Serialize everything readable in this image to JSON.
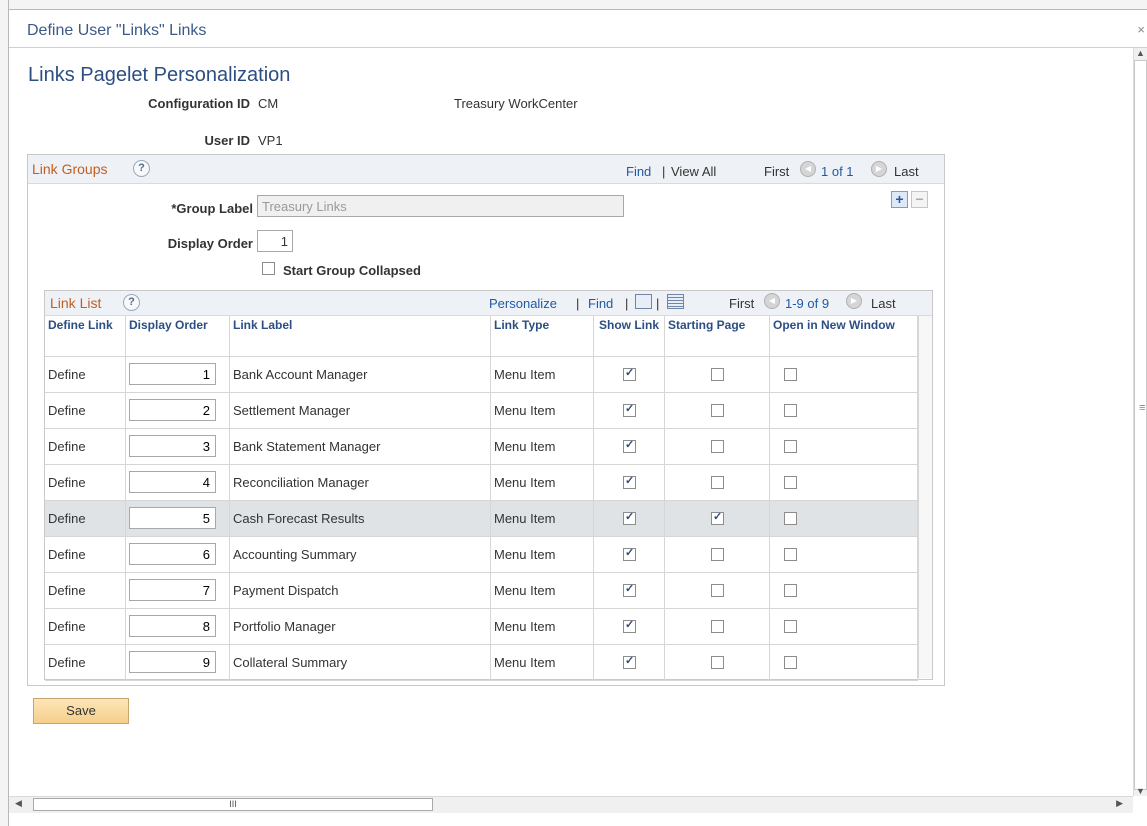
{
  "modal": {
    "title": "Define User \"Links\" Links",
    "close_glyph": "×"
  },
  "page": {
    "title": "Links Pagelet Personalization"
  },
  "config": {
    "config_id_label": "Configuration ID",
    "config_id_value": "CM",
    "config_desc": "Treasury WorkCenter",
    "user_id_label": "User ID",
    "user_id_value": "VP1"
  },
  "link_groups": {
    "title": "Link Groups",
    "help": "?",
    "find": "Find",
    "separator": "|",
    "view_all": "View All",
    "first": "First",
    "range": "1 of 1",
    "last": "Last",
    "add_glyph": "+",
    "delete_glyph": "−",
    "group_label_label": "*Group Label",
    "group_label_value": "Treasury Links",
    "display_order_label": "Display Order",
    "display_order_value": "1",
    "start_collapsed_label": "Start Group Collapsed"
  },
  "link_list": {
    "title": "Link List",
    "help": "?",
    "personalize": "Personalize",
    "find": "Find",
    "separator": "|",
    "first": "First",
    "range": "1-9 of 9",
    "last": "Last",
    "columns": [
      "Define Link",
      "Display Order",
      "Link Label",
      "Link Type",
      "Show Link",
      "Starting Page",
      "Open in New Window"
    ],
    "rows": [
      {
        "define": "Define",
        "order": "1",
        "label": "Bank Account Manager",
        "type": "Menu Item",
        "show": true,
        "starting": false,
        "new_window": false
      },
      {
        "define": "Define",
        "order": "2",
        "label": "Settlement Manager",
        "type": "Menu Item",
        "show": true,
        "starting": false,
        "new_window": false
      },
      {
        "define": "Define",
        "order": "3",
        "label": "Bank Statement Manager",
        "type": "Menu Item",
        "show": true,
        "starting": false,
        "new_window": false
      },
      {
        "define": "Define",
        "order": "4",
        "label": "Reconciliation Manager",
        "type": "Menu Item",
        "show": true,
        "starting": false,
        "new_window": false
      },
      {
        "define": "Define",
        "order": "5",
        "label": "Cash Forecast Results",
        "type": "Menu Item",
        "show": true,
        "starting": true,
        "new_window": false,
        "highlight": true
      },
      {
        "define": "Define",
        "order": "6",
        "label": "Accounting Summary",
        "type": "Menu Item",
        "show": true,
        "starting": false,
        "new_window": false
      },
      {
        "define": "Define",
        "order": "7",
        "label": "Payment Dispatch",
        "type": "Menu Item",
        "show": true,
        "starting": false,
        "new_window": false
      },
      {
        "define": "Define",
        "order": "8",
        "label": "Portfolio Manager",
        "type": "Menu Item",
        "show": true,
        "starting": false,
        "new_window": false
      },
      {
        "define": "Define",
        "order": "9",
        "label": "Collateral Summary",
        "type": "Menu Item",
        "show": true,
        "starting": false,
        "new_window": false
      }
    ]
  },
  "buttons": {
    "save": "Save"
  },
  "scrollbar": {
    "h_thumb_glyph": "III",
    "grip_glyph": "≡"
  },
  "colors": {
    "accent_orange": "#c45d21",
    "link_blue": "#1f5aa8",
    "title_blue": "#2c4e82",
    "highlight_row": "#dfe3e5"
  }
}
